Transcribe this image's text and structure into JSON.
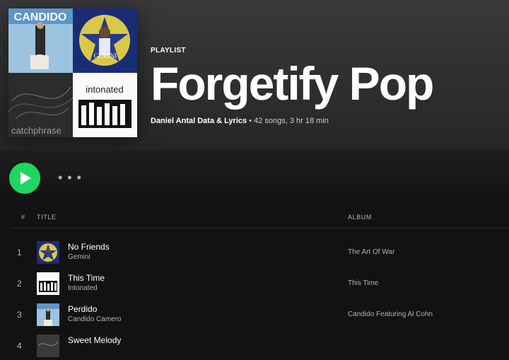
{
  "playlist": {
    "type_label": "PLAYLIST",
    "title": "Forgetify Pop",
    "owner": "Daniel Antal Data & Lyrics",
    "separator": " • ",
    "stats": "42 songs, 3 hr 18 min"
  },
  "covers": {
    "candido_text": "CANDIDO",
    "gemini_text": "GEMINI",
    "catchphrase_text": "catchphrase",
    "intonated_text": "intonated"
  },
  "controls": {
    "more_label": "• • •"
  },
  "columns": {
    "number": "#",
    "title": "TITLE",
    "album": "ALBUM"
  },
  "tracks": [
    {
      "number": "1",
      "title": "No Friends",
      "artist": "Gemini",
      "album": "The Art Of War",
      "cover": "gemini"
    },
    {
      "number": "2",
      "title": "This Time",
      "artist": "Intonated",
      "album": "This Time",
      "cover": "intonated"
    },
    {
      "number": "3",
      "title": "Perdido",
      "artist": "Candido Camero",
      "album": "Candido Featuring Al Cohn",
      "cover": "candido"
    },
    {
      "number": "4",
      "title": "Sweet Melody",
      "artist": "",
      "album": "",
      "cover": "catchphrase"
    }
  ],
  "colors": {
    "accent": "#1ed760",
    "background": "#121212",
    "text_secondary": "#b3b3b3"
  }
}
